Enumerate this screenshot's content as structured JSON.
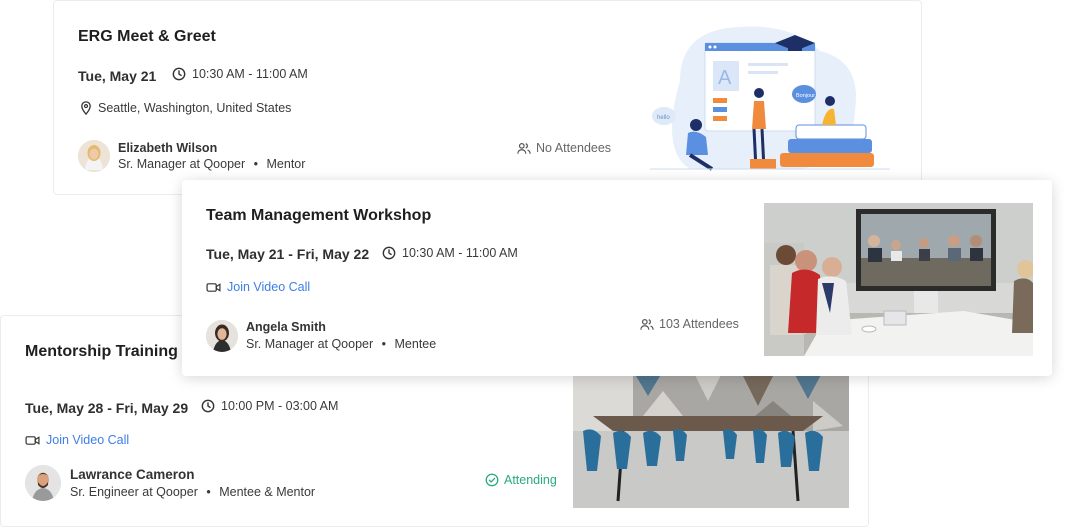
{
  "events": [
    {
      "title": "ERG Meet & Greet",
      "date": "Tue, May 21",
      "time": "10:30 AM - 11:00 AM",
      "location": "Seattle, Washington, United States",
      "host": {
        "name": "Elizabeth Wilson",
        "role": "Sr. Manager at Qooper",
        "relation": "Mentor"
      },
      "attendance": "No Attendees",
      "icons": {
        "time": "clock-icon",
        "location": "map-pin-icon",
        "attendance": "people-icon"
      }
    },
    {
      "title": "Team Management Workshop",
      "date": "Tue, May 21 - Fri, May 22",
      "time": "10:30 AM - 11:00 AM",
      "video_link": "Join Video Call",
      "host": {
        "name": "Angela Smith",
        "role": "Sr. Manager at Qooper",
        "relation": "Mentee"
      },
      "attendance": "103 Attendees",
      "icons": {
        "time": "clock-icon",
        "video": "video-camera-icon",
        "attendance": "people-icon"
      }
    },
    {
      "title": "Mentorship Training E",
      "date": "Tue, May 28 - Fri, May 29",
      "time": "10:00 PM - 03:00 AM",
      "video_link": "Join Video Call",
      "host": {
        "name": "Lawrance Cameron",
        "role": "Sr. Engineer at Qooper",
        "relation": "Mentee & Mentor"
      },
      "attendance": "Attending",
      "icons": {
        "time": "clock-icon",
        "video": "video-camera-icon",
        "attendance": "check-circle-icon"
      }
    }
  ],
  "illustration": {
    "bubble_left": "hello",
    "bubble_right": "Bonjour",
    "letter": "A"
  },
  "separator": "•",
  "colors": {
    "link": "#3d7ee6",
    "attending": "#2bab7a",
    "illustration_bg": "#e6effa",
    "chair": "#2a6f9c"
  }
}
